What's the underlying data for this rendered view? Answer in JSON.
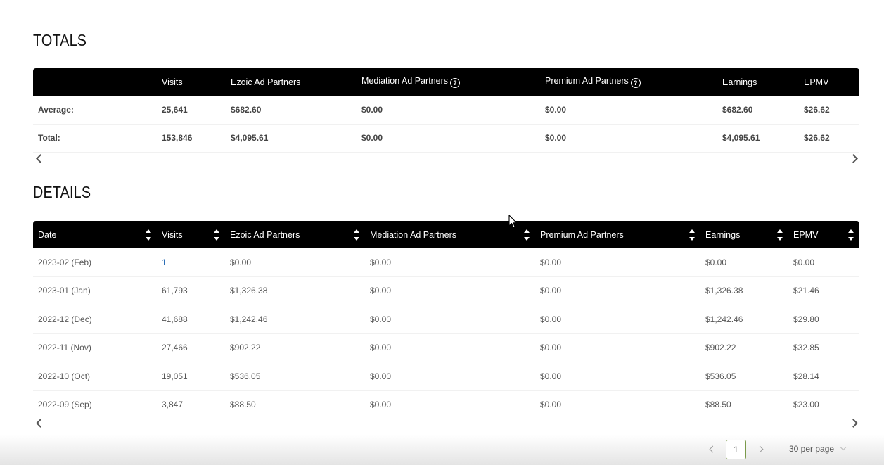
{
  "totals": {
    "title": "TOTALS",
    "columns": [
      "",
      "Visits",
      "Ezoic Ad Partners",
      "Mediation Ad Partners",
      "Premium Ad Partners",
      "Earnings",
      "EPMV"
    ],
    "rows": [
      {
        "label": "Average:",
        "visits": "25,641",
        "ezoic": "$682.60",
        "mediation": "$0.00",
        "premium": "$0.00",
        "earnings": "$682.60",
        "epmv": "$26.62"
      },
      {
        "label": "Total:",
        "visits": "153,846",
        "ezoic": "$4,095.61",
        "mediation": "$0.00",
        "premium": "$0.00",
        "earnings": "$4,095.61",
        "epmv": "$26.62"
      }
    ]
  },
  "details": {
    "title": "DETAILS",
    "columns": [
      "Date",
      "Visits",
      "Ezoic Ad Partners",
      "Mediation Ad Partners",
      "Premium Ad Partners",
      "Earnings",
      "EPMV"
    ],
    "rows": [
      {
        "date": "2023-02 (Feb)",
        "visits": "1",
        "ezoic": "$0.00",
        "mediation": "$0.00",
        "premium": "$0.00",
        "earnings": "$0.00",
        "epmv": "$0.00"
      },
      {
        "date": "2023-01 (Jan)",
        "visits": "61,793",
        "ezoic": "$1,326.38",
        "mediation": "$0.00",
        "premium": "$0.00",
        "earnings": "$1,326.38",
        "epmv": "$21.46"
      },
      {
        "date": "2022-12 (Dec)",
        "visits": "41,688",
        "ezoic": "$1,242.46",
        "mediation": "$0.00",
        "premium": "$0.00",
        "earnings": "$1,242.46",
        "epmv": "$29.80"
      },
      {
        "date": "2022-11 (Nov)",
        "visits": "27,466",
        "ezoic": "$902.22",
        "mediation": "$0.00",
        "premium": "$0.00",
        "earnings": "$902.22",
        "epmv": "$32.85"
      },
      {
        "date": "2022-10 (Oct)",
        "visits": "19,051",
        "ezoic": "$536.05",
        "mediation": "$0.00",
        "premium": "$0.00",
        "earnings": "$536.05",
        "epmv": "$28.14"
      },
      {
        "date": "2022-09 (Sep)",
        "visits": "3,847",
        "ezoic": "$88.50",
        "mediation": "$0.00",
        "premium": "$0.00",
        "earnings": "$88.50",
        "epmv": "$23.00"
      }
    ]
  },
  "icons": {
    "help": "?"
  },
  "pagination": {
    "current_page": "1",
    "per_page": "30 per page"
  },
  "colors": {
    "header_bg": "#000000",
    "link": "#2a6db5",
    "page_border": "#7a9a4a"
  }
}
